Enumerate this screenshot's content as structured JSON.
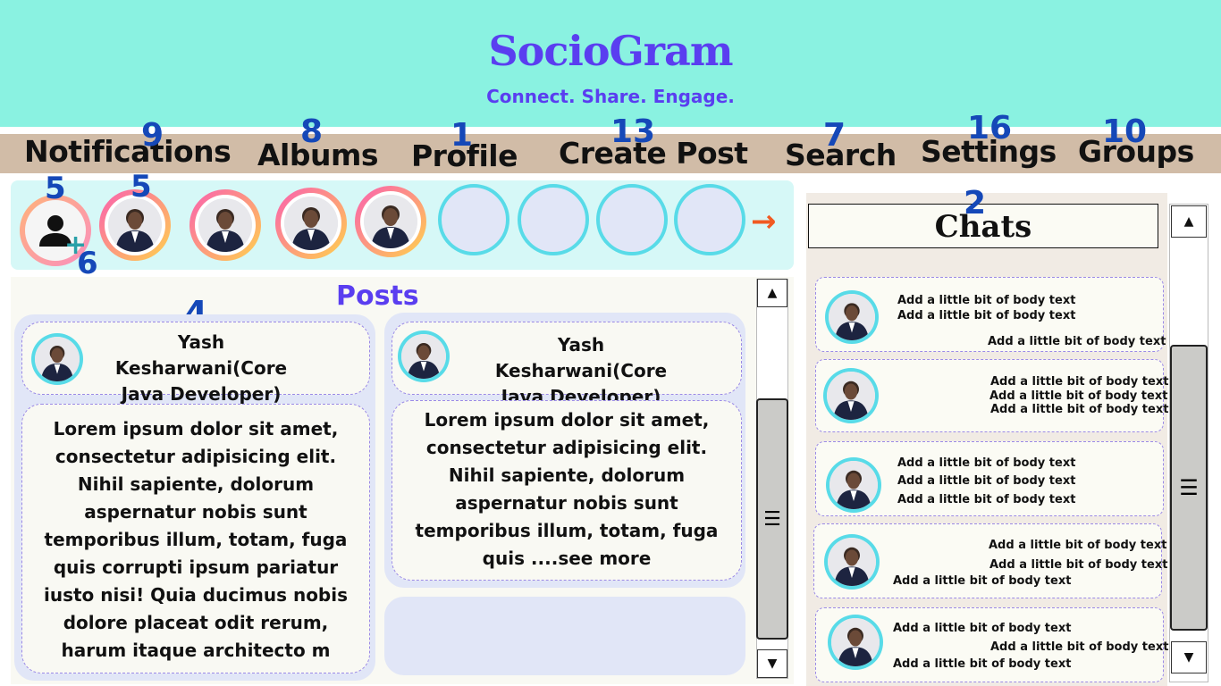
{
  "app": {
    "title": "SocioGram",
    "tagline": "Connect. Share. Engage."
  },
  "nav": {
    "items": [
      {
        "label": "Notifications",
        "badge": "9"
      },
      {
        "label": "Albums",
        "badge": "8"
      },
      {
        "label": "Profile",
        "badge": "1"
      },
      {
        "label": "Create Post",
        "badge": "13"
      },
      {
        "label": "Search",
        "badge": "7"
      },
      {
        "label": "Settings",
        "badge": "16"
      },
      {
        "label": "Groups",
        "badge": "10"
      }
    ]
  },
  "stories": {
    "add_badge": "5",
    "add_plus": "+",
    "add_plus_badge": "6",
    "first_story_badge": "5",
    "next_arrow": "→"
  },
  "posts": {
    "title": "Posts",
    "badge": "4",
    "items": [
      {
        "author_line1": "Yash Kesharwani(Core",
        "author_line2": "Java Developer)",
        "body": "Lorem ipsum dolor sit amet, consectetur adipisicing elit. Nihil sapiente, dolorum aspernatur nobis sunt temporibus illum, totam, fuga quis corrupti ipsum pariatur iusto nisi! Quia ducimus nobis dolore placeat odit rerum, harum itaque architecto m"
      },
      {
        "author_line1": "Yash Kesharwani(Core",
        "author_line2": "Java Developer)",
        "body": "Lorem ipsum dolor sit amet, consectetur adipisicing elit. Nihil sapiente, dolorum aspernatur nobis sunt temporibus illum, totam, fuga quis   ....see more"
      }
    ]
  },
  "chats": {
    "title": "Chats",
    "badge": "2",
    "line_text": "Add a little bit of body text"
  },
  "scrollbar": {
    "up": "▲",
    "down": "▼",
    "grip": "☰"
  },
  "colors": {
    "header_bg": "#8af2e1",
    "brand": "#5a3ef0",
    "nav_bg": "#d1bca7",
    "badge": "#1548b8",
    "story_ring_start": "#fa5fb0",
    "story_ring_end": "#ffd24d",
    "story_empty_ring": "#58dbe8",
    "arrow": "#f15a22"
  }
}
